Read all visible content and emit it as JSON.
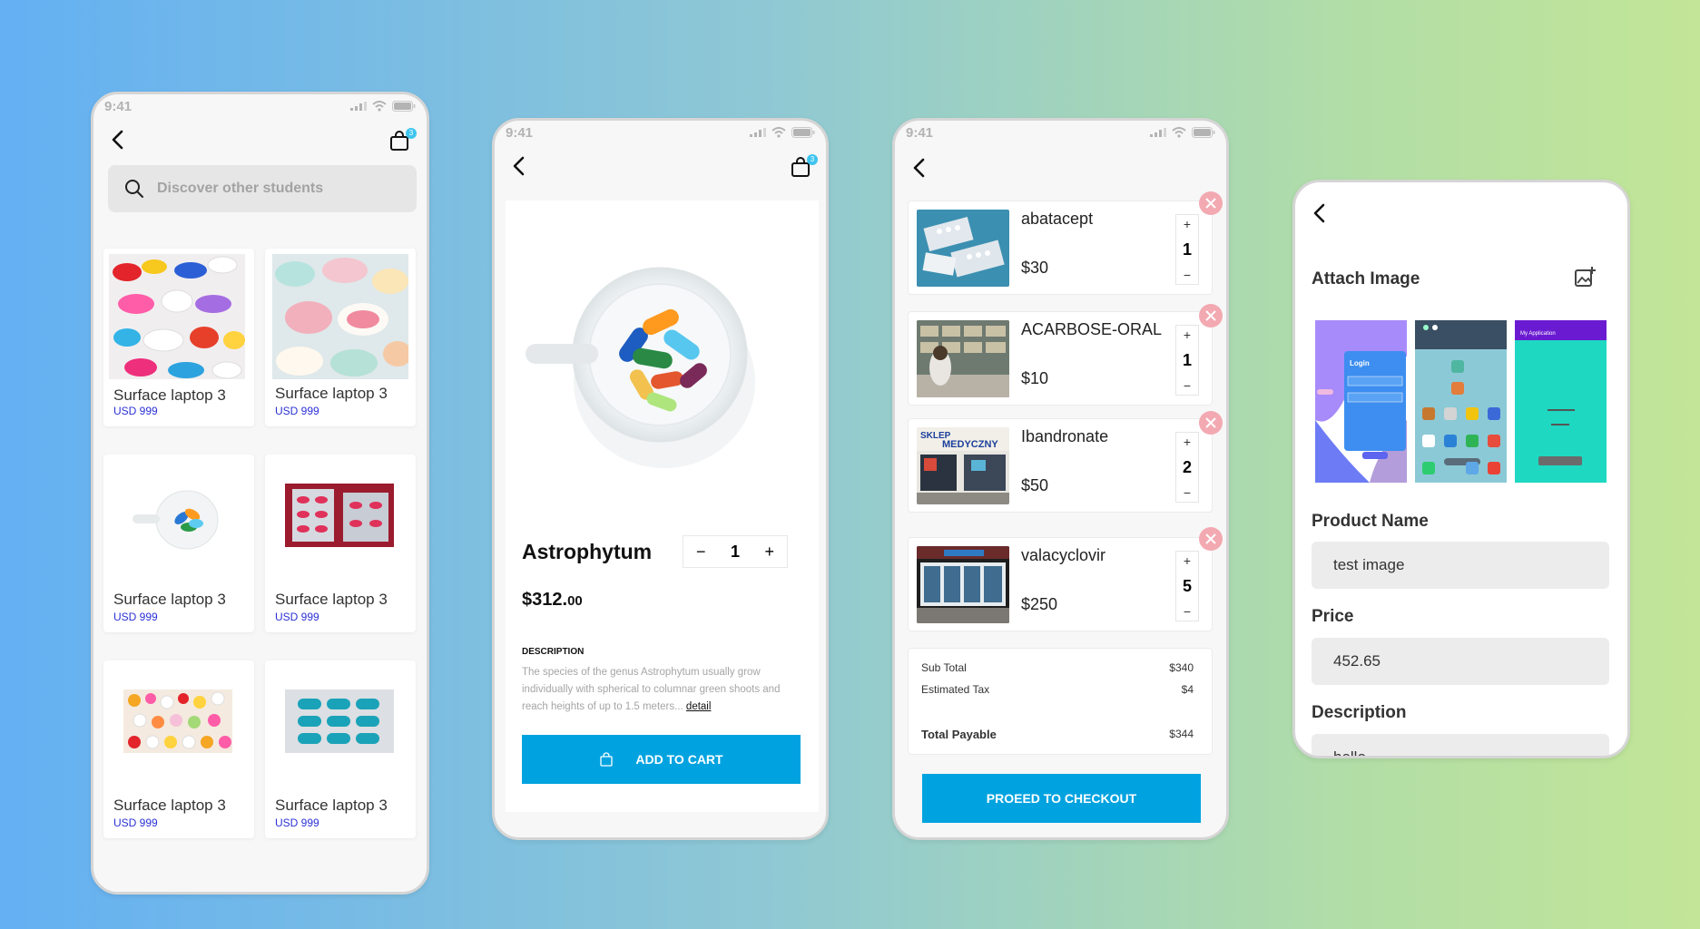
{
  "status": {
    "time": "9:41"
  },
  "phone1": {
    "search_placeholder": "Discover other students",
    "cart_count": "3",
    "products": [
      {
        "name": "Surface laptop 3",
        "price": "USD 999"
      },
      {
        "name": "Surface laptop 3",
        "price": "USD 999"
      },
      {
        "name": "Surface laptop 3",
        "price": "USD 999"
      },
      {
        "name": "Surface laptop 3",
        "price": "USD 999"
      },
      {
        "name": "Surface laptop 3",
        "price": "USD 999"
      },
      {
        "name": "Surface laptop 3",
        "price": "USD 999"
      }
    ]
  },
  "phone2": {
    "cart_count": "3",
    "product_name": "Astrophytum",
    "quantity": "1",
    "qty_minus": "−",
    "qty_plus": "+",
    "price_main": "$312.",
    "price_cents": "00",
    "description_heading": "DESCRIPTION",
    "description_text": "The species of the genus Astrophytum usually grow individually with spherical to columnar green shoots and reach heights of up to 1.5 meters...",
    "detail_link": "detail",
    "add_to_cart": "ADD TO CART"
  },
  "phone3": {
    "items": [
      {
        "name": "abatacept",
        "price": "$30",
        "qty": "1"
      },
      {
        "name": "ACARBOSE-ORAL",
        "price": "$10",
        "qty": "1"
      },
      {
        "name": "Ibandronate",
        "price": "$50",
        "qty": "2"
      },
      {
        "name": "valacyclovir",
        "price": "$250",
        "qty": "5"
      }
    ],
    "stepper_plus": "+",
    "stepper_minus": "−",
    "subtotal_label": "Sub Total",
    "subtotal_value": "$340",
    "tax_label": "Estimated Tax",
    "tax_value": "$4",
    "total_label": "Total Payable",
    "total_value": "$344",
    "checkout": "PROEED TO CHECKOUT"
  },
  "phone4": {
    "attach_label": "Attach Image",
    "product_name_label": "Product Name",
    "product_name_value": "test image",
    "price_label": "Price",
    "price_value": "452.65",
    "description_label": "Description",
    "description_value": "hello",
    "shot1_login": "Login",
    "shot3_title": "My Application"
  },
  "colors": {
    "accent": "#00a3e0",
    "price_blue": "#2a30d6",
    "remove_pink": "#f3a9b1",
    "badge": "#3ec5f0"
  }
}
